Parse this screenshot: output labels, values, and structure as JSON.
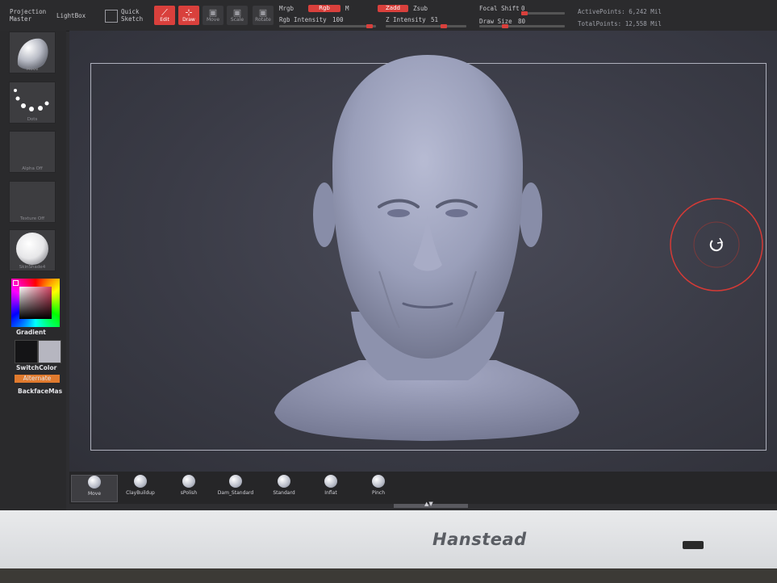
{
  "topbar": {
    "projection_master_line1": "Projection",
    "projection_master_line2": "Master",
    "lightbox": "LightBox",
    "quick_sketch_line1": "Quick",
    "quick_sketch_line2": "Sketch",
    "edit": "Edit",
    "draw": "Draw",
    "move": "Move",
    "scale": "Scale",
    "rotate": "Rotate",
    "mrgb": "Mrgb",
    "rgb": "Rgb",
    "m": "M",
    "zadd": "Zadd",
    "zsub": "Zsub",
    "rgb_intensity_label": "Rgb Intensity",
    "rgb_intensity_value": "100",
    "z_intensity_label": "Z Intensity",
    "z_intensity_value": "51",
    "focal_shift_label": "Focal Shift",
    "focal_shift_value": "0",
    "draw_size_label": "Draw Size",
    "draw_size_value": "80",
    "active_points": "ActivePoints: 6,242 Mil",
    "total_points": "TotalPoints: 12,558 Mil"
  },
  "leftbar": {
    "brush_tile": "Move",
    "stroke_tile": "Dots",
    "alpha_tile": "Alpha Off",
    "texture_tile": "Texture Off",
    "material_tile": "SkinShade4",
    "gradient": "Gradient",
    "switchcolor": "SwitchColor",
    "alternate": "Alternate",
    "backfacemask": "BackfaceMas"
  },
  "brushes": [
    {
      "label": "Move"
    },
    {
      "label": "ClayBuildup"
    },
    {
      "label": "sPolish"
    },
    {
      "label": "Dam_Standard"
    },
    {
      "label": "Standard"
    },
    {
      "label": "Inflat"
    },
    {
      "label": "Pinch"
    }
  ],
  "monitor": {
    "brand": "Hanstead"
  },
  "colors": {
    "accent": "#d9403c",
    "alternate": "#e07a2e",
    "clay": "#9a9fba"
  }
}
